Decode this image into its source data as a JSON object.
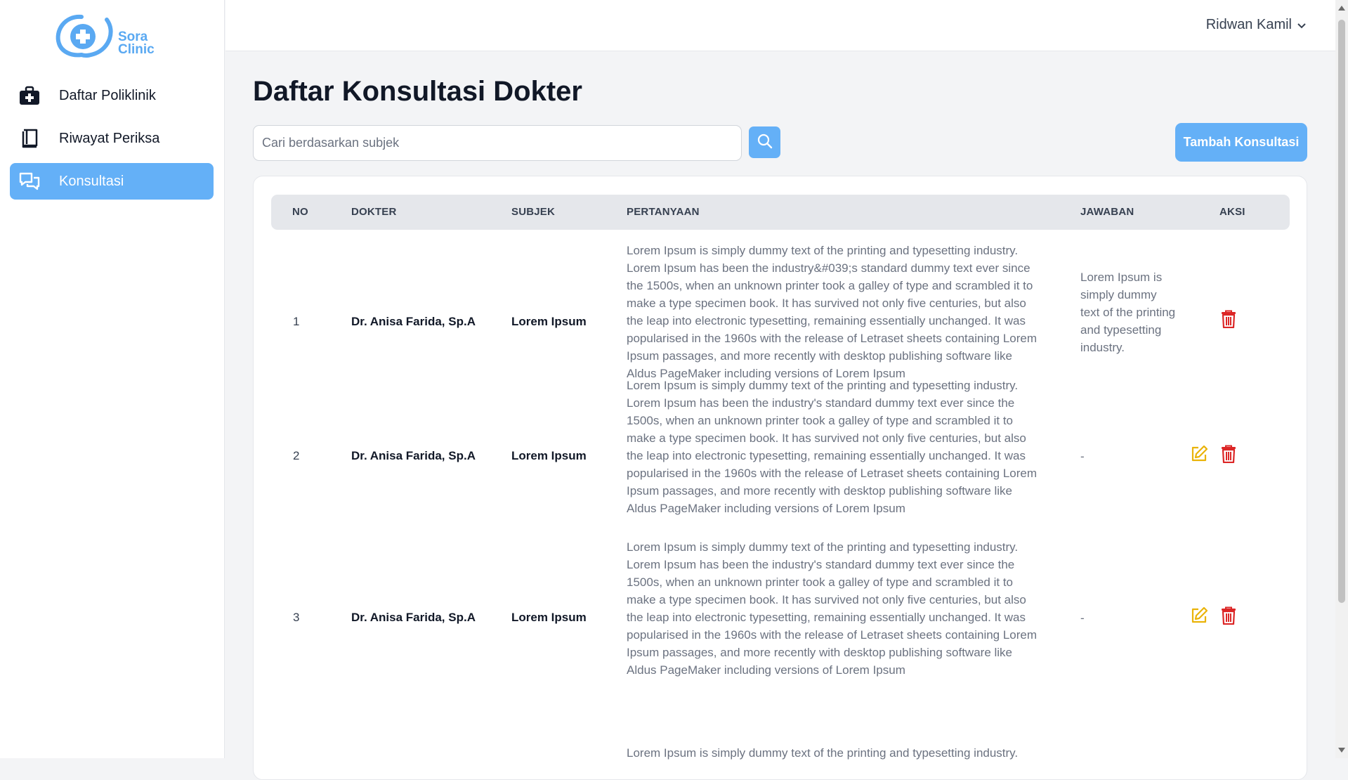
{
  "brand": {
    "line1": "Sora",
    "line2": "Clinic",
    "color": "#5aa9f2"
  },
  "sidebar": {
    "items": [
      {
        "label": "Daftar Poliklinik",
        "icon": "medical-kit-icon",
        "active": false
      },
      {
        "label": "Riwayat Periksa",
        "icon": "book-icon",
        "active": false
      },
      {
        "label": "Konsultasi",
        "icon": "chat-icon",
        "active": true
      }
    ]
  },
  "header": {
    "user_name": "Ridwan Kamil"
  },
  "main": {
    "title": "Daftar Konsultasi Dokter",
    "search": {
      "placeholder": "Cari berdasarkan subjek",
      "value": ""
    },
    "add_button": "Tambah Konsultasi",
    "accent": "#64b0f7"
  },
  "table": {
    "headers": {
      "no": "NO",
      "dokter": "DOKTER",
      "subjek": "SUBJEK",
      "pertanyaan": "PERTANYAAN",
      "jawaban": "JAWABAN",
      "aksi": "AKSI"
    },
    "rows": [
      {
        "no": "1",
        "dokter": "Dr. Anisa Farida, Sp.A",
        "subjek": "Lorem Ipsum",
        "pertanyaan": "Lorem Ipsum is simply dummy text of the printing and typesetting industry. Lorem Ipsum has been the industry&#039;s standard dummy text ever since the 1500s, when an unknown printer took a galley of type and scrambled it to make a type specimen book. It has survived not only five centuries, but also the leap into electronic typesetting, remaining essentially unchanged. It was popularised in the 1960s with the release of Letraset sheets containing Lorem Ipsum passages, and more recently with desktop publishing software like Aldus PageMaker including versions of Lorem Ipsum",
        "jawaban": "Lorem Ipsum is simply dummy text of the printing and typesetting industry.",
        "actions": [
          "delete"
        ]
      },
      {
        "no": "2",
        "dokter": "Dr. Anisa Farida, Sp.A",
        "subjek": "Lorem Ipsum",
        "pertanyaan": "Lorem Ipsum is simply dummy text of the printing and typesetting industry. Lorem Ipsum has been the industry's standard dummy text ever since the 1500s, when an unknown printer took a galley of type and scrambled it to make a type specimen book. It has survived not only five centuries, but also the leap into electronic typesetting, remaining essentially unchanged. It was popularised in the 1960s with the release of Letraset sheets containing Lorem Ipsum passages, and more recently with desktop publishing software like Aldus PageMaker including versions of Lorem Ipsum",
        "jawaban": "-",
        "actions": [
          "edit",
          "delete"
        ]
      },
      {
        "no": "3",
        "dokter": "Dr. Anisa Farida, Sp.A",
        "subjek": "Lorem Ipsum",
        "pertanyaan": "Lorem Ipsum is simply dummy text of the printing and typesetting industry. Lorem Ipsum has been the industry's standard dummy text ever since the 1500s, when an unknown printer took a galley of type and scrambled it to make a type specimen book. It has survived not only five centuries, but also the leap into electronic typesetting, remaining essentially unchanged. It was popularised in the 1960s with the release of Letraset sheets containing Lorem Ipsum passages, and more recently with desktop publishing software like Aldus PageMaker including versions of Lorem Ipsum",
        "jawaban": "-",
        "actions": [
          "edit",
          "delete"
        ]
      },
      {
        "pertanyaan": "Lorem Ipsum is simply dummy text of the printing and typesetting industry."
      }
    ]
  },
  "colors": {
    "edit": "#eab308",
    "delete": "#dc2626"
  }
}
